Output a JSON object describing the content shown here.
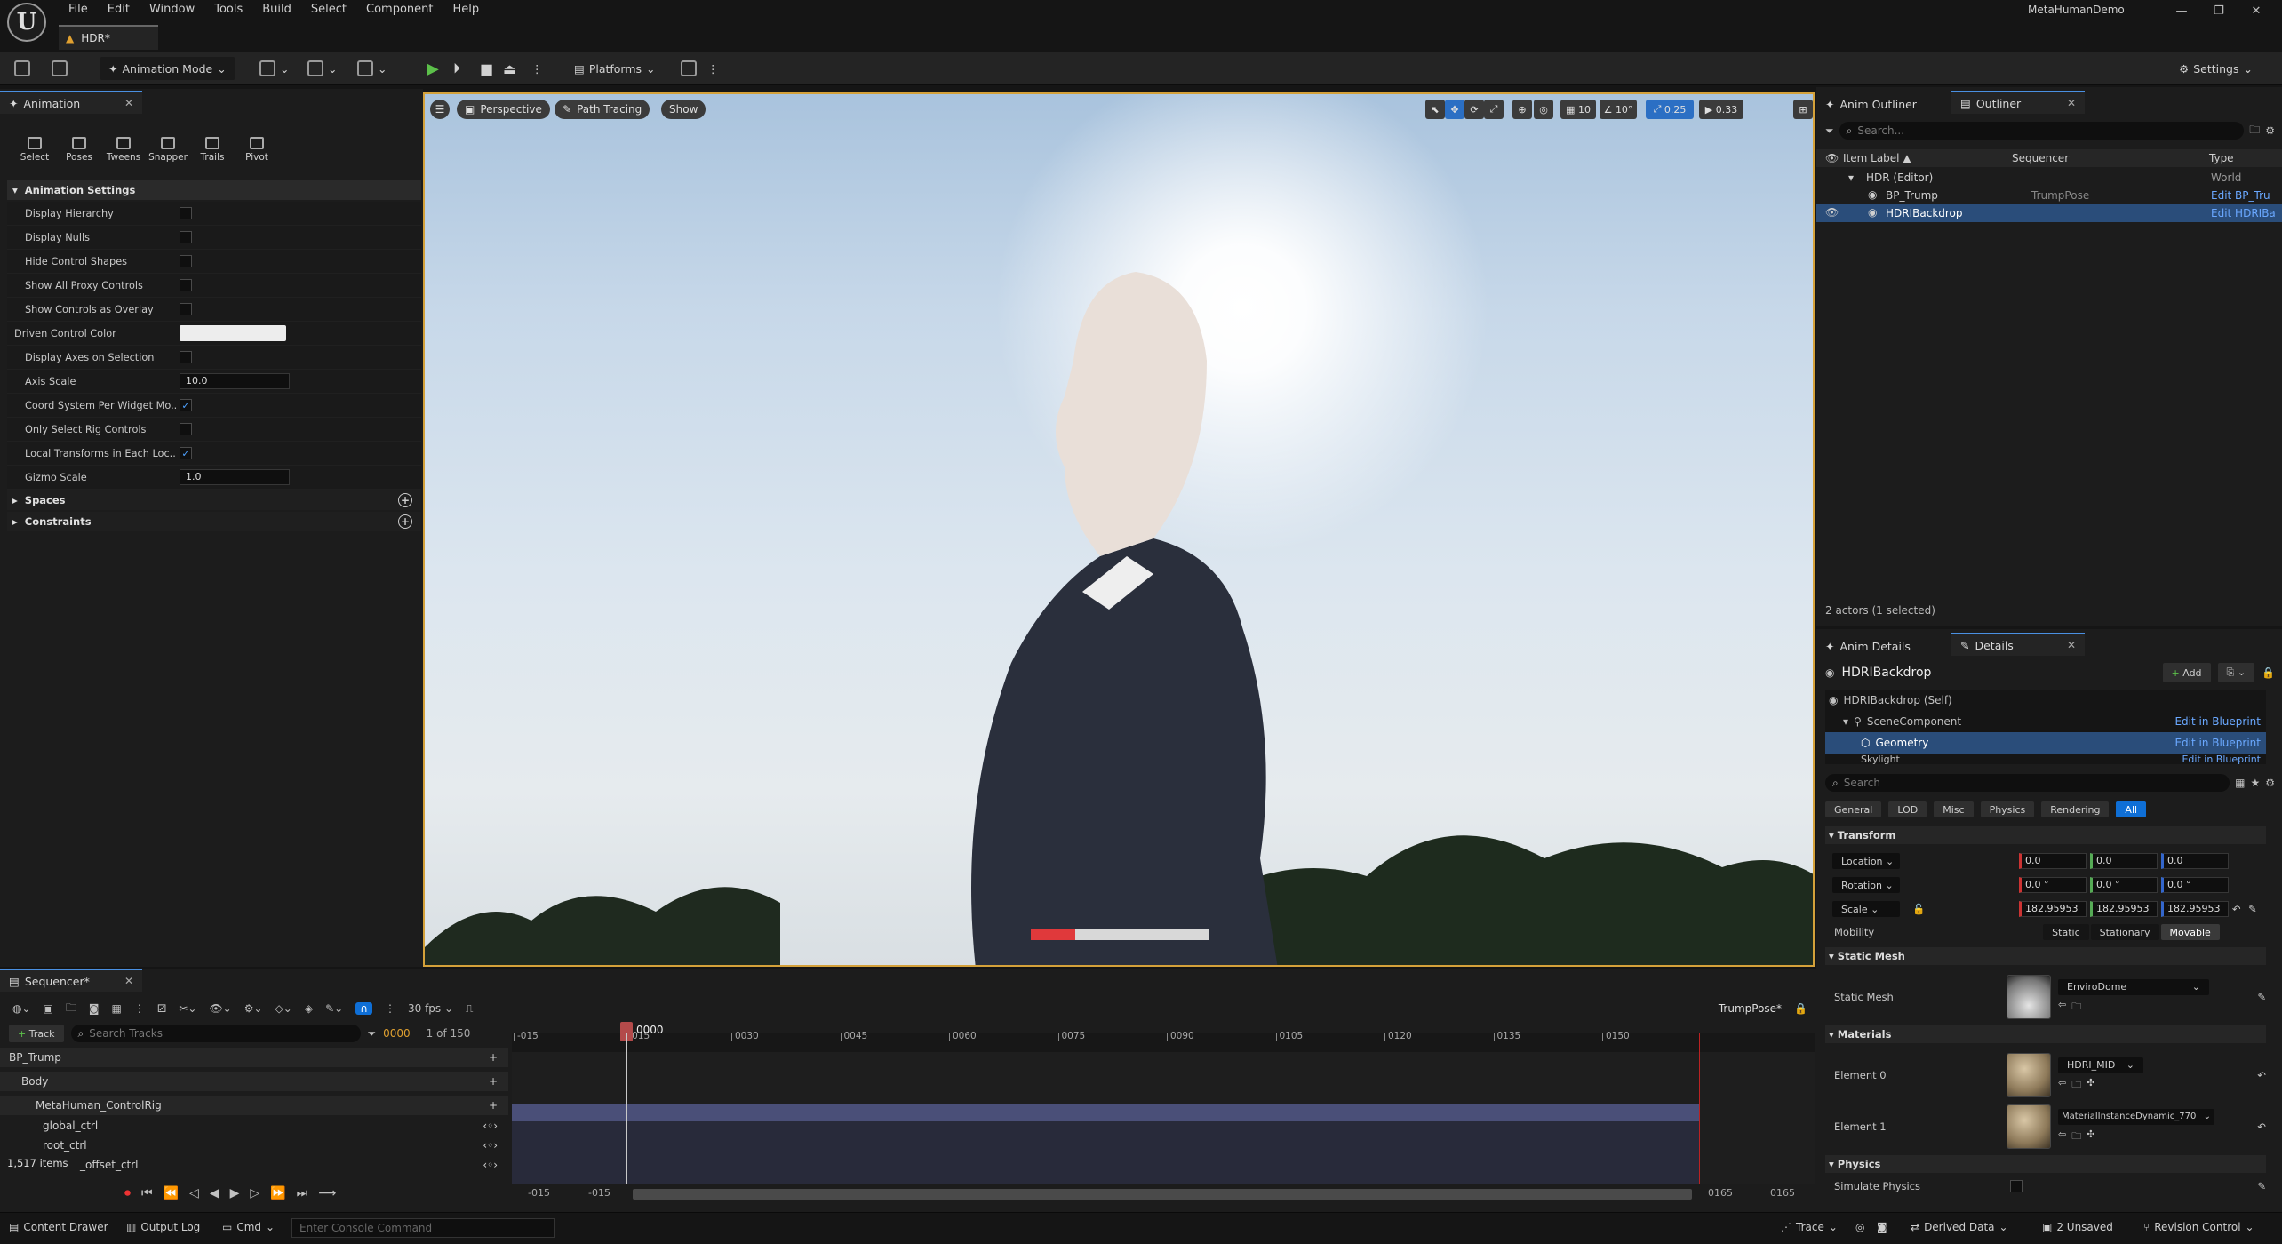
{
  "menu": [
    "File",
    "Edit",
    "Window",
    "Tools",
    "Build",
    "Select",
    "Component",
    "Help"
  ],
  "window": {
    "title": "MetaHumanDemo",
    "doc_tab": "HDR*"
  },
  "toolbar": {
    "mode": "Animation Mode",
    "platforms": "Platforms",
    "settings": "Settings"
  },
  "animation_panel": {
    "tab": "Animation",
    "tools": [
      "Select",
      "Poses",
      "Tweens",
      "Snapper",
      "Trails",
      "Pivot"
    ],
    "section": "Animation Settings",
    "props": [
      {
        "label": "Display Hierarchy",
        "type": "check",
        "value": false
      },
      {
        "label": "Display Nulls",
        "type": "check",
        "value": false
      },
      {
        "label": "Hide Control Shapes",
        "type": "check",
        "value": false
      },
      {
        "label": "Show All Proxy Controls",
        "type": "check",
        "value": false
      },
      {
        "label": "Show Controls as Overlay",
        "type": "check",
        "value": false
      },
      {
        "label": "Driven Control Color",
        "type": "color",
        "value": "#ededed"
      },
      {
        "label": "Display Axes on Selection",
        "type": "check",
        "value": false
      },
      {
        "label": "Axis Scale",
        "type": "num",
        "value": "10.0"
      },
      {
        "label": "Coord System Per Widget Mo...",
        "type": "check",
        "value": true
      },
      {
        "label": "Only Select Rig Controls",
        "type": "check",
        "value": false
      },
      {
        "label": "Local Transforms in Each Loc...",
        "type": "check",
        "value": true
      },
      {
        "label": "Gizmo Scale",
        "type": "num",
        "value": "1.0"
      }
    ],
    "spaces": "Spaces",
    "constraints": "Constraints"
  },
  "viewport": {
    "perspective": "Perspective",
    "path_tracing": "Path Tracing",
    "show": "Show",
    "grid": "10",
    "angle": "10°",
    "scale": "0.25",
    "camera_speed": "0.33",
    "render_progress": 0.25
  },
  "outliner": {
    "tabs": [
      "Anim Outliner",
      "Outliner"
    ],
    "search_placeholder": "Search...",
    "columns": [
      "Item Label ▲",
      "Sequencer",
      "Type"
    ],
    "rows": [
      {
        "label": "HDR (Editor)",
        "seq": "",
        "type": "World"
      },
      {
        "label": "BP_Trump",
        "seq": "TrumpPose",
        "type": "Edit BP_Tru"
      },
      {
        "label": "HDRIBackdrop",
        "seq": "",
        "type": "Edit HDRIBa"
      }
    ],
    "status": "2 actors (1 selected)"
  },
  "details": {
    "tabs": [
      "Anim Details",
      "Details"
    ],
    "actor": "HDRIBackdrop",
    "add": "Add",
    "components": [
      {
        "label": "HDRIBackdrop (Self)",
        "action": ""
      },
      {
        "label": "SceneComponent",
        "action": "Edit in Blueprint"
      },
      {
        "label": "Geometry",
        "action": "Edit in Blueprint"
      },
      {
        "label": "Skylight",
        "action": "Edit in Blueprint"
      }
    ],
    "search_placeholder": "Search",
    "filters": [
      "General",
      "LOD",
      "Misc",
      "Physics",
      "Rendering",
      "All"
    ],
    "transform_section": "Transform",
    "location": {
      "label": "Location",
      "x": "0.0",
      "y": "0.0",
      "z": "0.0"
    },
    "rotation": {
      "label": "Rotation",
      "x": "0.0 °",
      "y": "0.0 °",
      "z": "0.0 °"
    },
    "scale": {
      "label": "Scale",
      "x": "182.95953",
      "y": "182.95953",
      "z": "182.95953"
    },
    "mobility": {
      "label": "Mobility",
      "options": [
        "Static",
        "Stationary",
        "Movable"
      ]
    },
    "static_mesh_section": "Static Mesh",
    "static_mesh": {
      "label": "Static Mesh",
      "value": "EnviroDome"
    },
    "materials_section": "Materials",
    "element0": {
      "label": "Element 0",
      "value": "HDRI_MID"
    },
    "element1": {
      "label": "Element 1",
      "value": "MaterialInstanceDynamic_770"
    },
    "physics_section": "Physics",
    "simulate_physics": "Simulate Physics"
  },
  "sequencer": {
    "tab": "Sequencer*",
    "fps": "30 fps",
    "sequence_name": "TrumpPose*",
    "track_button": "Track",
    "search_placeholder": "Search Tracks",
    "current_frame": "0000",
    "frame_count": "1 of 150",
    "playhead": "0000",
    "ticks": [
      "-015",
      "0015",
      "0030",
      "0045",
      "0060",
      "0075",
      "0090",
      "0105",
      "0120",
      "0135",
      "0150"
    ],
    "tracks": [
      "BP_Trump",
      "Body",
      "MetaHuman_ControlRig",
      "global_ctrl",
      "root_ctrl",
      "_offset_ctrl"
    ],
    "items_count": "1,517 items",
    "range_start_a": "-015",
    "range_start_b": "-015",
    "range_end_a": "0165",
    "range_end_b": "0165"
  },
  "status": {
    "content_drawer": "Content Drawer",
    "output_log": "Output Log",
    "cmd": "Cmd",
    "console_placeholder": "Enter Console Command",
    "trace": "Trace",
    "derived_data": "Derived Data",
    "unsaved": "2 Unsaved",
    "revision": "Revision Control"
  }
}
